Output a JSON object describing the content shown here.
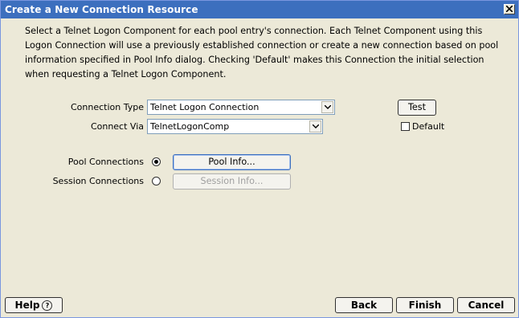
{
  "window": {
    "title": "Create a New Connection Resource"
  },
  "intro_text": "Select a Telnet Logon Component for each pool entry's connection. Each Telnet Component using this Logon Connection will use a previously established connection or create a new connection based on pool information specified in Pool Info dialog. Checking 'Default' makes this Connection the initial selection when requesting a Telnet Logon Component.",
  "form": {
    "connection_type_label": "Connection Type",
    "connection_type_value": "Telnet Logon Connection",
    "connect_via_label": "Connect Via",
    "connect_via_value": "TelnetLogonComp",
    "test_label": "Test",
    "default_label": "Default",
    "default_checked": false,
    "pool_connections_label": "Pool Connections",
    "session_connections_label": "Session Connections",
    "pool_info_label": "Pool Info...",
    "session_info_label": "Session Info...",
    "selected_mode": "pool"
  },
  "footer": {
    "help_label": "Help",
    "help_icon": "?",
    "back_label": "Back",
    "finish_label": "Finish",
    "cancel_label": "Cancel"
  }
}
